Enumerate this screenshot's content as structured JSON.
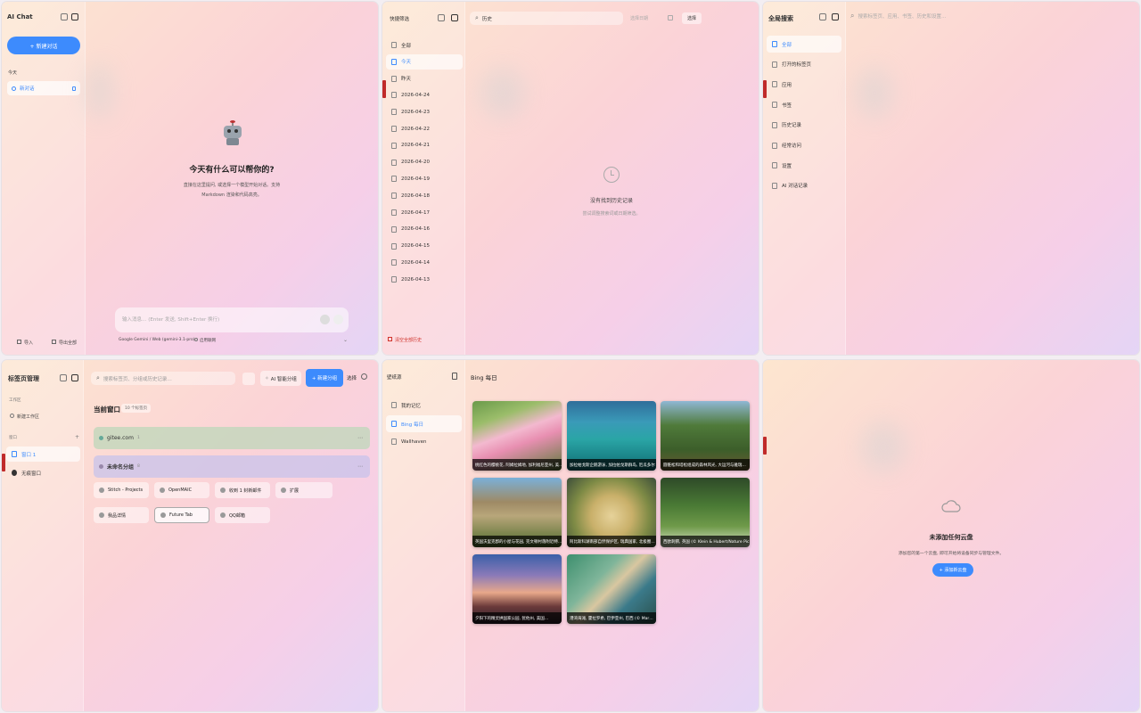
{
  "colors": {
    "accent": "#3d8bfd",
    "danger": "#d0342c"
  },
  "ai_chat": {
    "title": "AI Chat",
    "new_chat": "+ 新建对话",
    "section_today": "今天",
    "conversation": "新对话",
    "heading": "今天有什么可以帮你的?",
    "subtitle_line1": "直接在这里提问, 或选择一个模型开始对话。支持",
    "subtitle_line2": "Markdown 渲染和代码高亮。",
    "input_placeholder": "输入消息… (Enter 发送, Shift+Enter 换行)",
    "model": "Google Gemini / Web (gemini-3.1-pro)",
    "web_toggle": "启用联网",
    "import": "导入",
    "export": "导出全部"
  },
  "history": {
    "title": "快捷筛选",
    "search_value": "历史",
    "filter_placeholder": "选择日期",
    "select_button": "选择",
    "items": [
      "全部",
      "今天",
      "昨天",
      "2026-04-24",
      "2026-04-23",
      "2026-04-22",
      "2026-04-21",
      "2026-04-20",
      "2026-04-19",
      "2026-04-18",
      "2026-04-17",
      "2026-04-16",
      "2026-04-15",
      "2026-04-14",
      "2026-04-13"
    ],
    "empty_title": "没有找到历史记录",
    "empty_sub": "尝试调整搜索词或日期筛选。",
    "clear": "清空全部历史"
  },
  "global_search": {
    "title": "全局搜索",
    "placeholder": "搜索标签页、应用、书签、历史和设置…",
    "items": [
      "全部",
      "打开的标签页",
      "应用",
      "书签",
      "历史记录",
      "经常访问",
      "设置",
      "AI 对话记录"
    ]
  },
  "tab_manager": {
    "title": "标签页管理",
    "search_placeholder": "搜索标签页、分组或历史记录…",
    "ai_group": "AI 智能分组",
    "new_group": "+ 新建分组",
    "select": "选择",
    "workspace_label": "工作区",
    "new_workspace": "新建工作区",
    "window_label": "窗口",
    "window_item": "窗口 1",
    "incognito": "无痕窗口",
    "current_window": "当前窗口",
    "tab_count": "10 个标签页",
    "group1": "gitee.com",
    "group1_count": "1",
    "group2": "未命名分组",
    "group2_count": "8",
    "tabs": [
      "Stitch - Projects",
      "OpenMAIC",
      "收到 1 封新邮件",
      "扩展",
      "我品详情",
      "Future Tab",
      "QQ邮箱"
    ]
  },
  "wallpaper": {
    "title": "壁纸源",
    "nav": [
      "我的记忆",
      "Bing 每日",
      "Wallhaven"
    ],
    "heading": "Bing 每日",
    "captions": [
      "桃红色的樱桃花, 阿姆拉姆地, 加利福尼亚州, 美…",
      "加拉帕戈斯企鹅游泳, 加拉帕戈斯群岛, 厄瓜多尔",
      "圆锥松和塔松组成的森林风光, 大运河与雅瑞…",
      "英国沃里克郡的小屋与花园, 克文顿村落附近特…",
      "阿比斯科湖南部自然保护区, 瑞典国家, 北极圈…",
      "西欧刺猬, 英国 (© Klein & Hubert/Nature Pic…",
      "夕阳下的精灵拱国家公园, 犹他州, 美国…",
      "港湾海滩, 霍拉罗希, 巴伊亚州, 巴西 (© Mar…"
    ]
  },
  "cloud": {
    "heading": "未添加任何云盘",
    "sub": "添加您的第一个云盘, 即可开始将设备同步与管理文件。",
    "button": "+ 添加新云盘"
  }
}
